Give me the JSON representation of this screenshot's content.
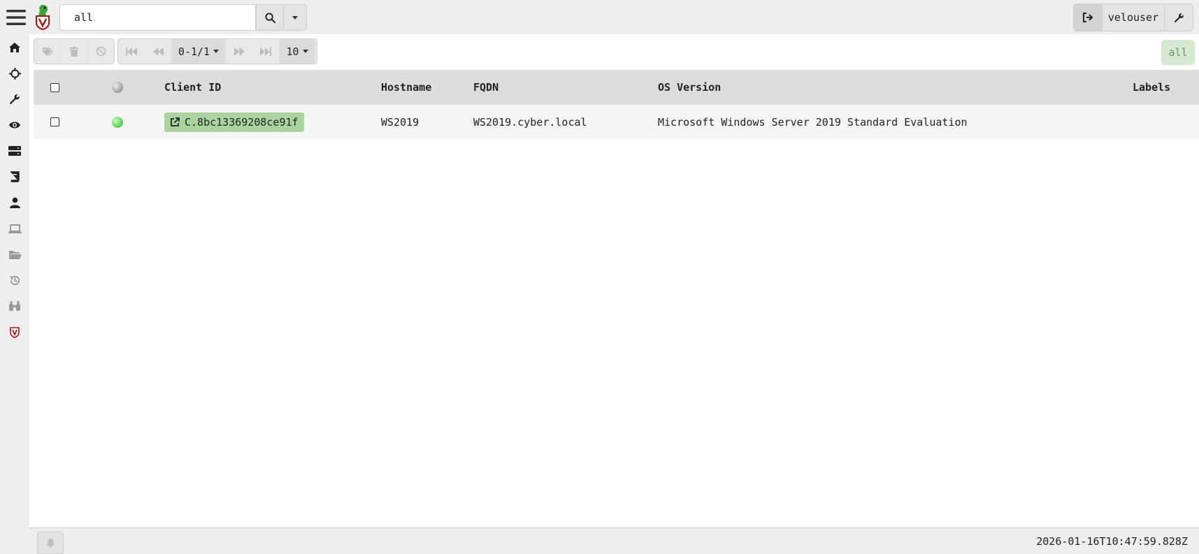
{
  "search": {
    "value": "all"
  },
  "user": {
    "name": "velouser"
  },
  "sidebar": {
    "items": [
      {
        "name": "home-icon"
      },
      {
        "name": "crosshairs-icon"
      },
      {
        "name": "wrench-icon"
      },
      {
        "name": "eye-icon"
      },
      {
        "name": "server-icon"
      },
      {
        "name": "book-icon"
      },
      {
        "name": "user-icon"
      },
      {
        "name": "laptop-icon"
      },
      {
        "name": "folder-open-icon"
      },
      {
        "name": "history-icon"
      },
      {
        "name": "binoculars-icon"
      },
      {
        "name": "velociraptor-shield-icon"
      }
    ]
  },
  "toolbar": {
    "page_range": "0-1/1",
    "page_size": "10",
    "filter_label": "all"
  },
  "table": {
    "headers": {
      "client_id": "Client ID",
      "hostname": "Hostname",
      "fqdn": "FQDN",
      "os_version": "OS Version",
      "labels": "Labels"
    },
    "rows": [
      {
        "client_id": "C.8bc13369208ce91f",
        "hostname": "WS2019",
        "fqdn": "WS2019.cyber.local",
        "os_version": "Microsoft Windows Server 2019 Standard Evaluation",
        "labels": "",
        "online": true
      }
    ]
  },
  "footer": {
    "timestamp": "2026-01-16T10:47:59.828Z"
  },
  "colors": {
    "client_pill": "#a9d4a0",
    "filter_badge_bg": "#d4e9d0",
    "online_green": "#5ad35a"
  }
}
